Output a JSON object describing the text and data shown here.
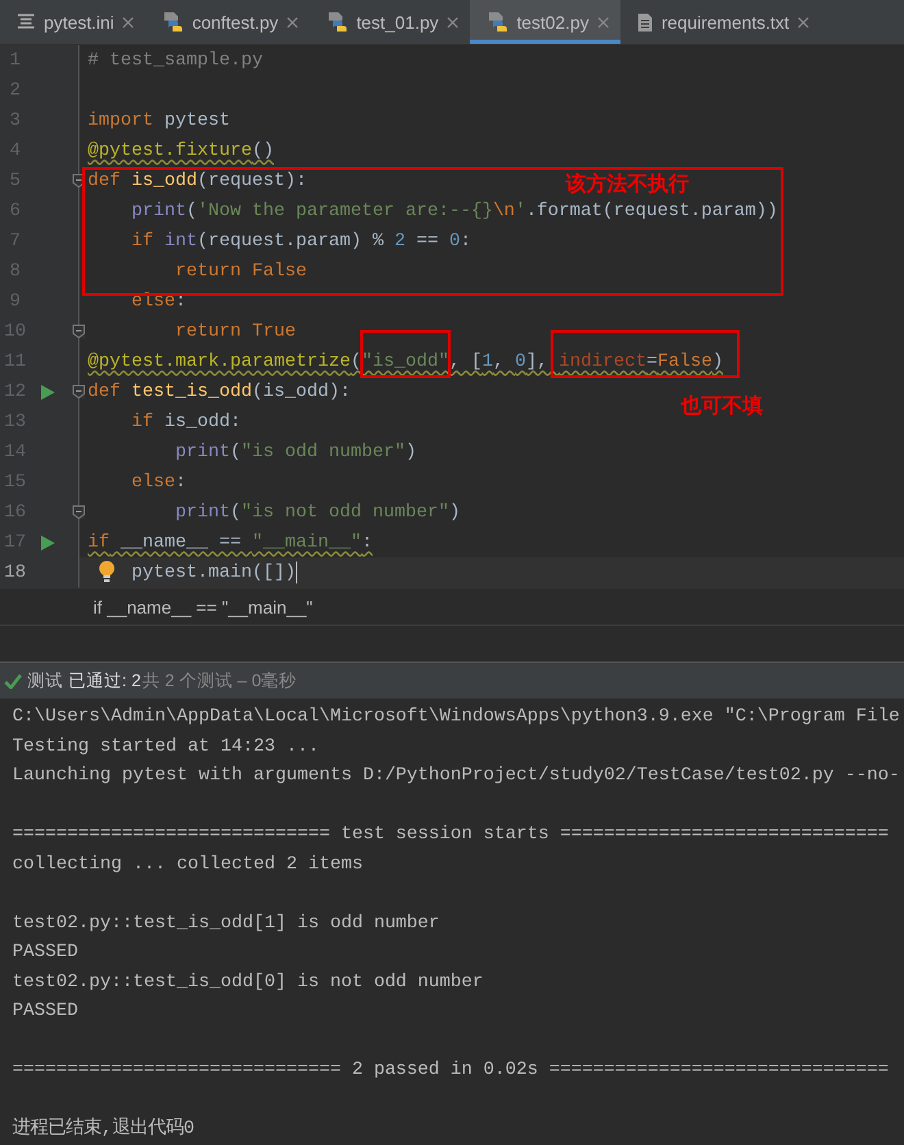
{
  "tabs": [
    {
      "label": "pytest.ini",
      "kind": "ini",
      "selected": false
    },
    {
      "label": "conftest.py",
      "kind": "python",
      "selected": false
    },
    {
      "label": "test_01.py",
      "kind": "python",
      "selected": false
    },
    {
      "label": "test02.py",
      "kind": "python",
      "selected": true
    },
    {
      "label": "requirements.txt",
      "kind": "text",
      "selected": false
    }
  ],
  "editor": {
    "lines": [
      {
        "number": "1",
        "run": false,
        "fold": false,
        "current": false,
        "tokens": [
          {
            "kind": "comment",
            "text": "# test_sample.py"
          }
        ]
      },
      {
        "number": "2",
        "run": false,
        "fold": false,
        "current": false
      },
      {
        "number": "3",
        "run": false,
        "fold": false,
        "current": false,
        "tokens": [
          {
            "kind": "keyword",
            "text": "import"
          },
          {
            "kind": "plain",
            "text": " pytest"
          }
        ]
      },
      {
        "number": "4",
        "run": false,
        "fold": false,
        "current": false,
        "tokens": [
          {
            "kind": "decorator",
            "text": "@pytest.fixture",
            "warn": true
          },
          {
            "kind": "plain",
            "text": "()",
            "warn": true
          }
        ]
      },
      {
        "number": "5",
        "run": false,
        "fold": true,
        "current": false,
        "tokens": [
          {
            "kind": "keyword",
            "text": "def "
          },
          {
            "kind": "function",
            "text": "is_odd"
          },
          {
            "kind": "plain",
            "text": "(request):"
          }
        ]
      },
      {
        "number": "6",
        "run": false,
        "fold": false,
        "current": false,
        "tokens": [
          {
            "kind": "builtin",
            "text": "    print"
          },
          {
            "kind": "plain",
            "text": "("
          },
          {
            "kind": "string",
            "text": "'Now the parameter are:--{}"
          },
          {
            "kind": "keyword",
            "text": "\\n"
          },
          {
            "kind": "string",
            "text": "'"
          },
          {
            "kind": "plain",
            "text": ".format(request.param))"
          }
        ]
      },
      {
        "number": "7",
        "run": false,
        "fold": false,
        "current": false,
        "tokens": [
          {
            "kind": "keyword",
            "text": "    if "
          },
          {
            "kind": "builtin",
            "text": "int"
          },
          {
            "kind": "plain",
            "text": "(request.param) % "
          },
          {
            "kind": "number",
            "text": "2"
          },
          {
            "kind": "plain",
            "text": " == "
          },
          {
            "kind": "number",
            "text": "0"
          },
          {
            "kind": "plain",
            "text": ":"
          }
        ]
      },
      {
        "number": "8",
        "run": false,
        "fold": false,
        "current": false,
        "tokens": [
          {
            "kind": "keyword",
            "text": "        return False"
          }
        ]
      },
      {
        "number": "9",
        "run": false,
        "fold": false,
        "current": false,
        "tokens": [
          {
            "kind": "keyword",
            "text": "    else"
          },
          {
            "kind": "plain",
            "text": ":"
          }
        ]
      },
      {
        "number": "10",
        "run": false,
        "fold": true,
        "current": false,
        "tokens": [
          {
            "kind": "keyword",
            "text": "        return True"
          }
        ]
      },
      {
        "number": "11",
        "run": false,
        "fold": false,
        "current": false,
        "tokens": [
          {
            "kind": "decorator",
            "text": "@pytest.mark.parametrize",
            "warn": true
          },
          {
            "kind": "plain",
            "text": "(",
            "warn": true
          },
          {
            "kind": "string",
            "text": "\"is_odd\"",
            "warn": true
          },
          {
            "kind": "plain",
            "text": ", [",
            "warn": true
          },
          {
            "kind": "number",
            "text": "1",
            "warn": true
          },
          {
            "kind": "plain",
            "text": ", ",
            "warn": true
          },
          {
            "kind": "number",
            "text": "0",
            "warn": true
          },
          {
            "kind": "plain",
            "text": "], ",
            "warn": true
          },
          {
            "kind": "param",
            "text": "indirect",
            "warn": true
          },
          {
            "kind": "plain",
            "text": "=",
            "warn": true
          },
          {
            "kind": "keyword",
            "text": "False",
            "warn": true
          },
          {
            "kind": "plain",
            "text": ")",
            "warn": true
          }
        ]
      },
      {
        "number": "12",
        "run": true,
        "fold": true,
        "current": false,
        "tokens": [
          {
            "kind": "keyword",
            "text": "def "
          },
          {
            "kind": "function",
            "text": "test_is_odd"
          },
          {
            "kind": "plain",
            "text": "(is_odd):"
          }
        ]
      },
      {
        "number": "13",
        "run": false,
        "fold": false,
        "current": false,
        "tokens": [
          {
            "kind": "keyword",
            "text": "    if"
          },
          {
            "kind": "plain",
            "text": " is_odd:"
          }
        ]
      },
      {
        "number": "14",
        "run": false,
        "fold": false,
        "current": false,
        "tokens": [
          {
            "kind": "builtin",
            "text": "        print"
          },
          {
            "kind": "plain",
            "text": "("
          },
          {
            "kind": "string",
            "text": "\"is odd number\""
          },
          {
            "kind": "plain",
            "text": ")"
          }
        ]
      },
      {
        "number": "15",
        "run": false,
        "fold": false,
        "current": false,
        "tokens": [
          {
            "kind": "keyword",
            "text": "    else"
          },
          {
            "kind": "plain",
            "text": ":"
          }
        ]
      },
      {
        "number": "16",
        "run": false,
        "fold": true,
        "current": false,
        "tokens": [
          {
            "kind": "builtin",
            "text": "        print"
          },
          {
            "kind": "plain",
            "text": "("
          },
          {
            "kind": "string",
            "text": "\"is not odd number\""
          },
          {
            "kind": "plain",
            "text": ")"
          }
        ]
      },
      {
        "number": "17",
        "run": true,
        "fold": false,
        "current": false,
        "tokens": [
          {
            "kind": "keyword",
            "text": "if",
            "warn": true
          },
          {
            "kind": "plain",
            "text": " __name__ == ",
            "warn": true
          },
          {
            "kind": "string",
            "text": "\"__main__\"",
            "warn": true
          },
          {
            "kind": "plain",
            "text": ":",
            "warn": true
          }
        ]
      },
      {
        "number": "18",
        "run": false,
        "fold": false,
        "current": true,
        "tokens": [
          {
            "kind": "plain",
            "text": "    pytest.main([])"
          }
        ]
      }
    ],
    "breadcrumb": "if __name__ == \"__main__\""
  },
  "annotations": [
    {
      "kind": "note",
      "text": "该方法不执行"
    },
    {
      "kind": "box"
    },
    {
      "kind": "box"
    },
    {
      "kind": "box"
    },
    {
      "kind": "note",
      "text": "也可不填"
    }
  ],
  "test_status": {
    "passed": true,
    "label": "测试",
    "result": "已通过: 2",
    "summary": "共 2 个测试 – 0毫秒"
  },
  "console": [
    {
      "kind": "text",
      "text": "C:\\Users\\Admin\\AppData\\Local\\Microsoft\\WindowsApps\\python3.9.exe \"C:\\Program File"
    },
    {
      "kind": "text",
      "text": "Testing started at 14:23 ..."
    },
    {
      "kind": "text",
      "text": "Launching pytest with arguments D:/PythonProject/study02/TestCase/test02.py --no-"
    },
    {
      "kind": "gap"
    },
    {
      "kind": "text",
      "text": "============================= test session starts =============================="
    },
    {
      "kind": "text",
      "text": "collecting ... collected 2 items"
    },
    {
      "kind": "gap"
    },
    {
      "kind": "text",
      "text": "test02.py::test_is_odd[1] is odd number"
    },
    {
      "kind": "text",
      "text": "PASSED"
    },
    {
      "kind": "text",
      "text": "test02.py::test_is_odd[0] is not odd number"
    },
    {
      "kind": "text",
      "text": "PASSED"
    },
    {
      "kind": "gap"
    },
    {
      "kind": "text",
      "text": "============================== 2 passed in 0.02s ==============================="
    },
    {
      "kind": "gap"
    },
    {
      "kind": "text",
      "text": "进程已结束,退出代码0"
    }
  ]
}
